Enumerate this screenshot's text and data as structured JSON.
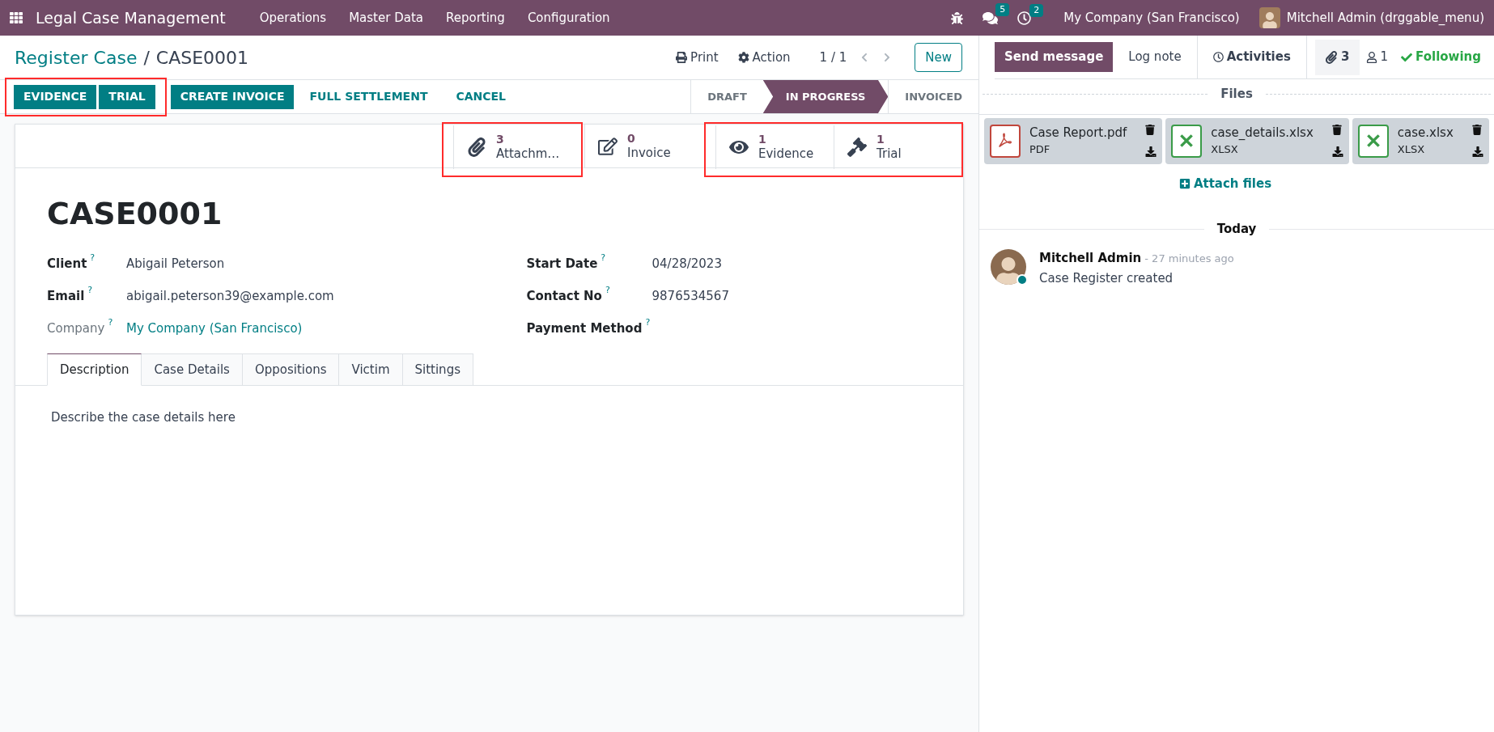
{
  "navbar": {
    "app_name": "Legal Case Management",
    "menus": [
      "Operations",
      "Master Data",
      "Reporting",
      "Configuration"
    ],
    "messages_count": "5",
    "activities_count": "2",
    "company": "My Company (San Francisco)",
    "user": "Mitchell Admin (drggable_menu)"
  },
  "breadcrumb": {
    "parent": "Register Case",
    "separator": "/",
    "current": "CASE0001"
  },
  "toolbar": {
    "print": "Print",
    "action": "Action",
    "pager": "1 / 1",
    "new": "New"
  },
  "action_button_groups": [
    {
      "highlighted": true,
      "buttons": [
        {
          "label": "EVIDENCE",
          "kind": "primary"
        },
        {
          "label": "TRIAL",
          "kind": "primary"
        }
      ]
    },
    {
      "highlighted": false,
      "buttons": [
        {
          "label": "CREATE INVOICE",
          "kind": "primary"
        },
        {
          "label": "FULL SETTLEMENT",
          "kind": "link"
        },
        {
          "label": "CANCEL",
          "kind": "link"
        }
      ]
    }
  ],
  "stages": [
    {
      "label": "DRAFT",
      "selected": false
    },
    {
      "label": "IN PROGRESS",
      "selected": true
    },
    {
      "label": "INVOICED",
      "selected": false
    }
  ],
  "smart_button_groups": [
    {
      "highlighted": true,
      "buttons": [
        {
          "count": "3",
          "label": "Attachm…",
          "kind": "attachments"
        }
      ]
    },
    {
      "highlighted": false,
      "buttons": [
        {
          "count": "0",
          "label": "Invoice",
          "kind": "invoice"
        }
      ]
    },
    {
      "highlighted": true,
      "buttons": [
        {
          "count": "1",
          "label": "Evidence",
          "kind": "evidence"
        },
        {
          "count": "1",
          "label": "Trial",
          "kind": "trial"
        }
      ]
    }
  ],
  "record_title": "CASE0001",
  "fields_left": [
    {
      "label": "Client",
      "value": "Abigail Peterson",
      "readonly": false,
      "link": false
    },
    {
      "label": "Email",
      "value": "abigail.peterson39@example.com",
      "readonly": false,
      "link": false
    },
    {
      "label": "Company",
      "value": "My Company (San Francisco)",
      "readonly": true,
      "link": true
    }
  ],
  "fields_right": [
    {
      "label": "Start Date",
      "value": "04/28/2023",
      "readonly": false,
      "link": false
    },
    {
      "label": "Contact No",
      "value": "9876534567",
      "readonly": false,
      "link": false
    },
    {
      "label": "Payment Method",
      "readonly": false
    }
  ],
  "help_mark": "?",
  "tabs": [
    {
      "label": "Description",
      "selected": true
    },
    {
      "label": "Case Details",
      "selected": false
    },
    {
      "label": "Oppositions",
      "selected": false
    },
    {
      "label": "Victim",
      "selected": false
    },
    {
      "label": "Sittings",
      "selected": false
    }
  ],
  "description": "Describe the case details here",
  "chatter": {
    "send_message": "Send message",
    "log_note": "Log note",
    "activities": "Activities",
    "attachments_count": "3",
    "followers_count": "1",
    "following": "Following",
    "files_heading": "Files",
    "files": [
      {
        "name": "Case Report.pdf",
        "type": "PDF",
        "kind": "pdf"
      },
      {
        "name": "case_details.xlsx",
        "type": "XLSX",
        "kind": "xlsx"
      },
      {
        "name": "case.xlsx",
        "type": "XLSX",
        "kind": "xlsx"
      }
    ],
    "attach_files": "Attach files",
    "date_separator": "Today",
    "messages": [
      {
        "author": "Mitchell Admin",
        "time": "- 27 minutes ago",
        "body": "Case Register created",
        "online": true
      }
    ]
  }
}
